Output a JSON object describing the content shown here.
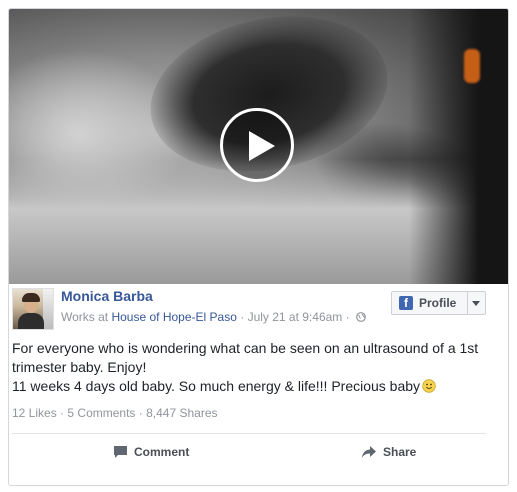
{
  "post": {
    "author": "Monica Barba",
    "works_at_prefix": "Works at",
    "workplace": "House of Hope-El Paso",
    "timestamp": "July 21 at 9:46am",
    "separator": "·",
    "profile_button_label": "Profile",
    "text_line1": "For everyone who is wondering what can be seen on an ultrasound of a 1st trimester baby. Enjoy!",
    "text_line2": "11 weeks 4 days old baby. So much energy & life!!! Precious baby",
    "stats": {
      "likes": "12 Likes",
      "comments": "5 Comments",
      "shares": "8,447 Shares"
    },
    "actions": {
      "comment": "Comment",
      "share": "Share"
    }
  },
  "icons": {
    "play": "play-icon",
    "facebook": "facebook-icon",
    "globe": "globe-icon",
    "smiley": "smiley-icon",
    "comment": "comment-icon",
    "share": "share-icon"
  },
  "colors": {
    "link_blue": "#365899",
    "meta_gray": "#90949c",
    "facebook_blue": "#4267b2"
  }
}
